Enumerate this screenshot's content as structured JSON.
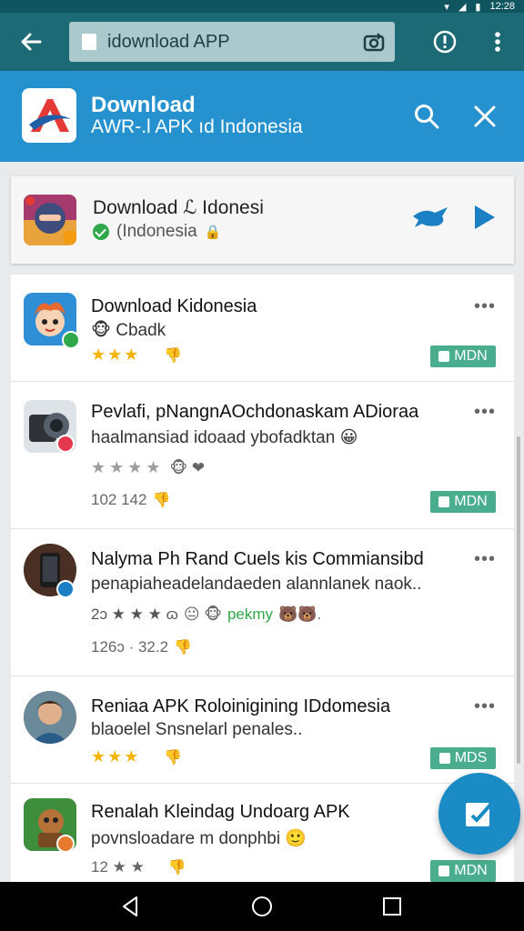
{
  "status_bar": {
    "time": "12:28"
  },
  "url_bar": {
    "url": "idownload APP"
  },
  "header": {
    "title": "Download",
    "subtitle": "AWR-.l APK ıd Indonesia"
  },
  "featured": {
    "title": "Download ℒ Idonesi",
    "subtitle": "(Indonesia"
  },
  "items": [
    {
      "title": "Download Kidonesia",
      "desc": "Cbadk",
      "stars": "★★★",
      "badge": "MDN"
    },
    {
      "title": "Pevlafi, pNangnAOchdonaskam ADioraa",
      "desc": "haalmansiad idoaad ybofadktan",
      "stars": "★★★★",
      "meta": "102  142",
      "badge": "MDN"
    },
    {
      "title": "Nalyma Ph Rand Cuels kis Commiansibd",
      "desc": "penapiaheadelandaeden alannlanek naok..",
      "stars": "2ɔ ★ ★ ★ ɷ",
      "tag": "pekmy",
      "meta": "126ɔ · 32.2"
    },
    {
      "title": "Reniaa APK Roloinigining IDdomesia",
      "desc": "blaoelel Snsnelarl penales..",
      "stars": "★★★",
      "badge": "MDS"
    },
    {
      "title": "Renalah Kleindag Undoarg APK",
      "desc": "povnsloadare m donphbi",
      "stars": "12 ★ ★",
      "badge": "MDN"
    }
  ],
  "colors": {
    "url_bar": "#1b6a76",
    "header": "#2592cf",
    "badge": "#4aae8e",
    "fab": "#1b8bc6"
  }
}
